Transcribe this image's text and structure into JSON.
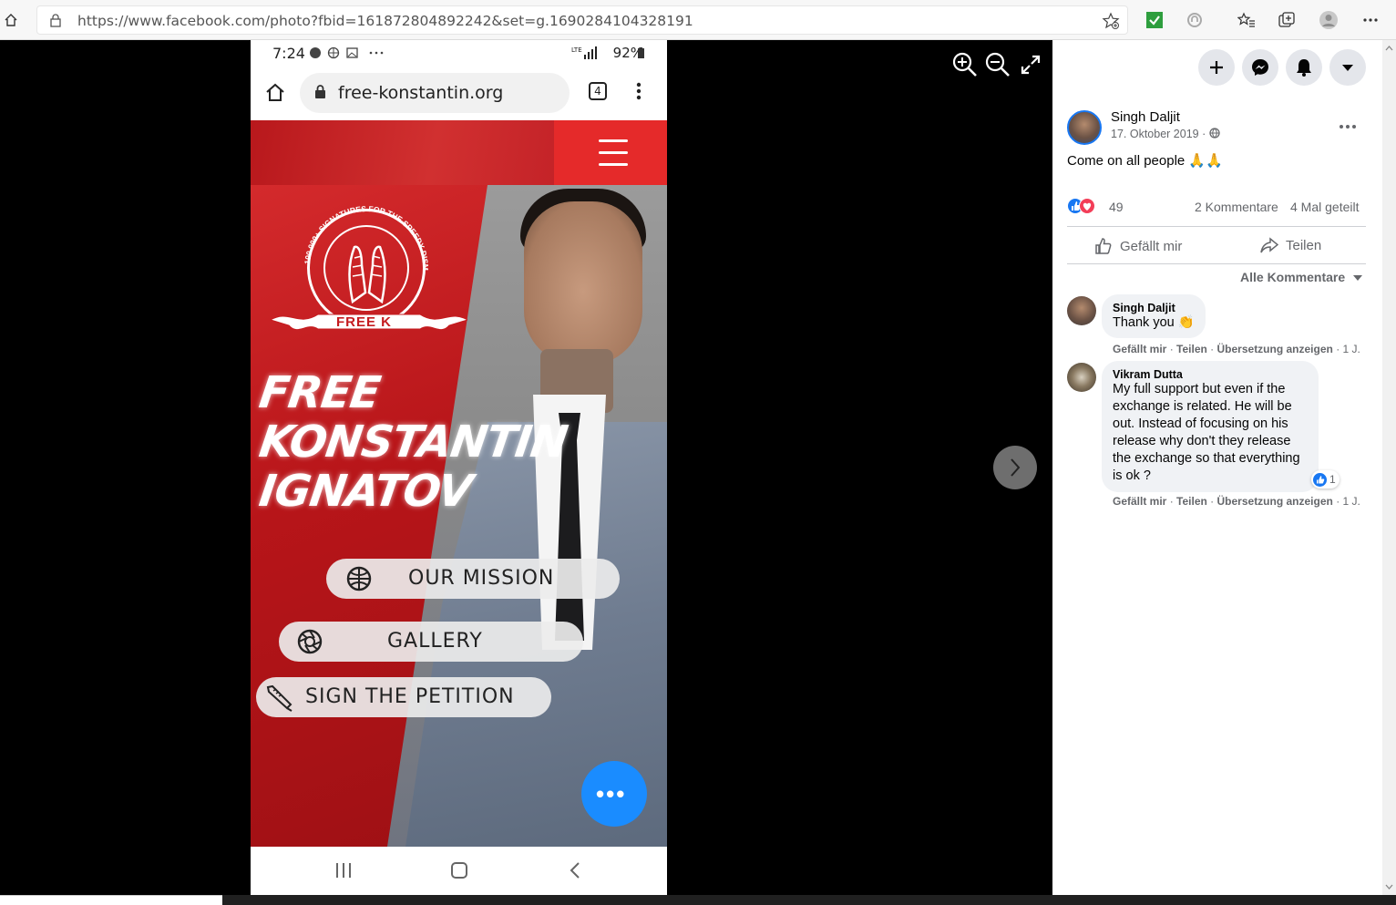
{
  "browser": {
    "url": "https://www.facebook.com/photo?fbid=161872804892242&set=g.1690284104328191"
  },
  "phone": {
    "status_time": "7:24",
    "status_right": "92%",
    "tab_count": "4",
    "url": "free-konstantin.org"
  },
  "site": {
    "logo_ring_text": "100 000+ SIGNATURES FOR THE SPEEDY DISMISSAL OF CHARGES",
    "banner_text": "FREE K",
    "title_lines": [
      "FREE",
      "KONSTANTIN",
      "IGNATOV"
    ],
    "buttons": [
      {
        "label": "OUR MISSION",
        "icon": "globe-icon"
      },
      {
        "label": "GALLERY",
        "icon": "aperture-icon"
      },
      {
        "label": "SIGN THE PETITION",
        "icon": "pen-icon"
      }
    ]
  },
  "post": {
    "author": "Singh Daljit",
    "date": "17. Oktober 2019 ·",
    "text": "Come on all people 🙏🙏",
    "reaction_count": "49",
    "comment_count": "2 Kommentare",
    "share_count": "4 Mal geteilt",
    "like_label": "Gefällt mir",
    "share_label": "Teilen",
    "sort_label": "Alle Kommentare"
  },
  "comments": [
    {
      "name": "Singh Daljit",
      "text": "Thank you 👏",
      "meta_like": "Gefällt mir",
      "meta_share": "Teilen",
      "meta_translate": "Übersetzung anzeigen",
      "meta_time": "1 J."
    },
    {
      "name": "Vikram Dutta",
      "text_lines": [
        "My full support but even if the",
        "exchange is related. He will be",
        "out. Instead of focusing on his",
        "release why don't they release",
        "the exchange so that everything",
        "is ok ?"
      ],
      "reaction_count": "1",
      "meta_like": "Gefällt mir",
      "meta_share": "Teilen",
      "meta_translate": "Übersetzung anzeigen",
      "meta_time": "1 J."
    }
  ],
  "colors": {
    "facebook_blue": "#1877f2",
    "site_red": "#c51b1f",
    "love_red": "#f33e58"
  }
}
